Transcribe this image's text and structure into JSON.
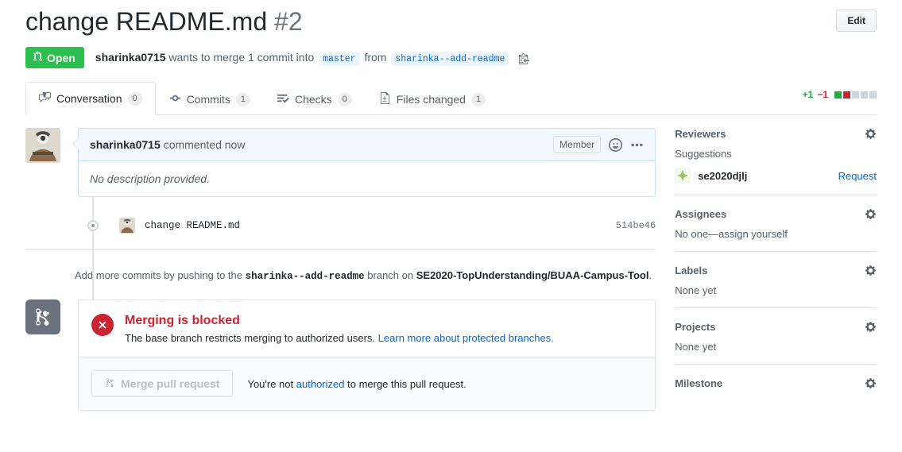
{
  "header": {
    "title": "change README.md",
    "number": "#2",
    "edit_label": "Edit",
    "state": "Open",
    "state_color": "#2cbe4e",
    "author": "sharinka0715",
    "meta_wants": "wants to merge 1 commit into",
    "base_branch": "master",
    "from_word": "from",
    "head_branch": "sharinka--add-readme"
  },
  "tabs": [
    {
      "label": "Conversation",
      "count": "0",
      "icon": "comment-discussion-icon",
      "active": true
    },
    {
      "label": "Commits",
      "count": "1",
      "icon": "git-commit-icon",
      "active": false
    },
    {
      "label": "Checks",
      "count": "0",
      "icon": "checklist-icon",
      "active": false
    },
    {
      "label": "Files changed",
      "count": "1",
      "icon": "file-diff-icon",
      "active": false
    }
  ],
  "diffstat": {
    "additions": "+1",
    "deletions": "−1",
    "add_color": "#28a745",
    "del_color": "#cb2431",
    "blocks": [
      "g",
      "r",
      "n",
      "n",
      "n"
    ]
  },
  "comment": {
    "author": "sharinka0715",
    "action": "commented now",
    "badge": "Member",
    "body": "No description provided."
  },
  "commit": {
    "message": "change README.md",
    "sha": "514be46"
  },
  "push_note": {
    "prefix": "Add more commits by pushing to the",
    "branch": "sharinka--add-readme",
    "middle": "branch on",
    "repo": "SE2020-TopUnderstanding/BUAA-Campus-Tool",
    "suffix": "."
  },
  "merge": {
    "status_title": "Merging is blocked",
    "status_desc": "The base branch restricts merging to authorized users.",
    "status_link": "Learn more about protected branches.",
    "button_label": "Merge pull request",
    "note_prefix": "You're not",
    "note_link": "authorized",
    "note_suffix": "to merge this pull request."
  },
  "sidebar": {
    "reviewers": {
      "title": "Reviewers",
      "suggestions_label": "Suggestions",
      "reviewer_name": "se2020djlj",
      "request_label": "Request"
    },
    "assignees": {
      "title": "Assignees",
      "value": "No one—assign yourself"
    },
    "labels": {
      "title": "Labels",
      "value": "None yet"
    },
    "projects": {
      "title": "Projects",
      "value": "None yet"
    },
    "milestone": {
      "title": "Milestone"
    }
  }
}
